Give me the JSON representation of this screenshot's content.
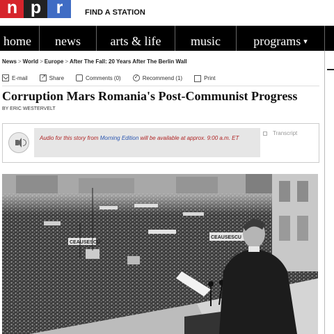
{
  "logo": {
    "letters": [
      "n",
      "p",
      "r"
    ],
    "colors": [
      "#d6242b",
      "#222222",
      "#3f6cc4"
    ]
  },
  "header": {
    "find_station": "FIND A STATION"
  },
  "nav": {
    "items": [
      {
        "label": "home"
      },
      {
        "label": "news"
      },
      {
        "label": "arts & life"
      },
      {
        "label": "music"
      },
      {
        "label": "programs",
        "caret": "▾"
      }
    ]
  },
  "breadcrumb": {
    "items": [
      "News",
      "World",
      "Europe",
      "After The Fall: 20 Years After The Berlin Wall"
    ],
    "separator": ">"
  },
  "toolbar": {
    "email": "E-mail",
    "share": "Share",
    "comments": "Comments (0)",
    "recommend": "Recommend (1)",
    "print": "Print"
  },
  "article": {
    "headline": "Corruption Mars Romania's Post-Communist Progress",
    "byline": "by ERIC WESTERVELT"
  },
  "audio": {
    "msg_before": "Audio for this story from ",
    "program": "Morning Edition",
    "msg_after": " will be available at approx. 9:00 a.m. ET",
    "transcript": "Transcript"
  },
  "photo": {
    "sign_1": "CEAUSESCU",
    "sign_2": "CEAUSESCU"
  }
}
